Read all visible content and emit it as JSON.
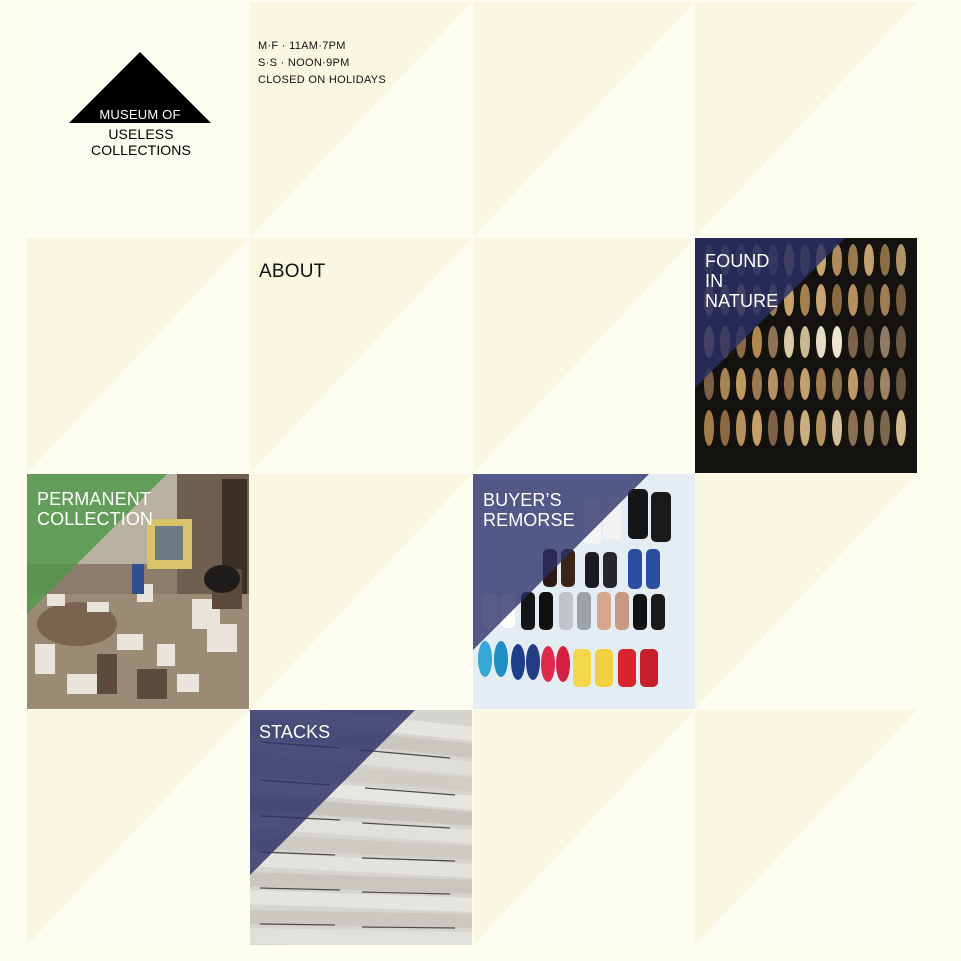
{
  "logo": {
    "line1": "MUSEUM OF",
    "line2": "USELESS COLLECTIONS",
    "icon": "triangle-logo-icon"
  },
  "hours": {
    "weekday": "M·F · 11AM·7PM",
    "weekend": "S·S · NOON·9PM",
    "holidays": "CLOSED ON HOLIDAYS"
  },
  "nav": {
    "about": "ABOUT"
  },
  "tiles": {
    "found_in_nature": {
      "line1": "FOUND",
      "line2": "IN",
      "line3": "NATURE"
    },
    "permanent_collection": {
      "line1": "PERMANENT",
      "line2": "COLLECTION"
    },
    "buyers_remorse": {
      "line1": "BUYER’S",
      "line2": "REMORSE"
    },
    "stacks": {
      "line1": "STACKS"
    }
  },
  "colors": {
    "background": "#fdfdf0",
    "tile_fold": "#f8f7e0",
    "overlay_navy": "#2a2f66",
    "overlay_green": "#4f9a4a"
  }
}
